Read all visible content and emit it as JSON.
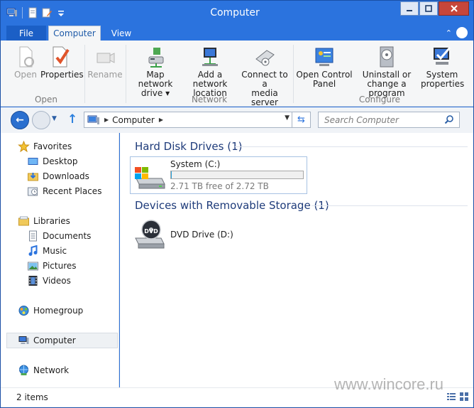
{
  "window": {
    "title": "Computer"
  },
  "ribbon_tabs": {
    "file": "File",
    "computer": "Computer",
    "view": "View"
  },
  "ribbon": {
    "groups": {
      "open": "Open",
      "network": "Network",
      "configure": "Configure"
    },
    "buttons": {
      "open": "Open",
      "properties": "Properties",
      "rename": "Rename",
      "map_network_drive_l1": "Map network",
      "map_network_drive_l2": "drive ▾",
      "add_network_location_l1": "Add a network",
      "add_network_location_l2": "location",
      "connect_media_server_l1": "Connect to a",
      "connect_media_server_l2": "media server",
      "open_control_panel_l1": "Open Control",
      "open_control_panel_l2": "Panel",
      "uninstall_program_l1": "Uninstall or",
      "uninstall_program_l2": "change a program",
      "system_properties_l1": "System",
      "system_properties_l2": "properties"
    }
  },
  "address": {
    "crumb": "Computer"
  },
  "search": {
    "placeholder": "Search Computer"
  },
  "nav": {
    "favorites": "Favorites",
    "desktop": "Desktop",
    "downloads": "Downloads",
    "recent_places": "Recent Places",
    "libraries": "Libraries",
    "documents": "Documents",
    "music": "Music",
    "pictures": "Pictures",
    "videos": "Videos",
    "homegroup": "Homegroup",
    "computer": "Computer",
    "network": "Network"
  },
  "content": {
    "hdd_group": "Hard Disk Drives (1)",
    "removable_group": "Devices with Removable Storage (1)",
    "system_drive": {
      "name": "System (C:)",
      "free_text": "2.71 TB free of 2.72 TB",
      "used_fraction": 0.004
    },
    "dvd_drive": {
      "name": "DVD Drive (D:)",
      "badge": "DVD"
    }
  },
  "status": {
    "item_count": "2 items"
  },
  "watermark": "www.wincore.ru",
  "colors": {
    "accent": "#2b73de",
    "group_header": "#1e3b7a",
    "selection": "#eef1f4"
  }
}
